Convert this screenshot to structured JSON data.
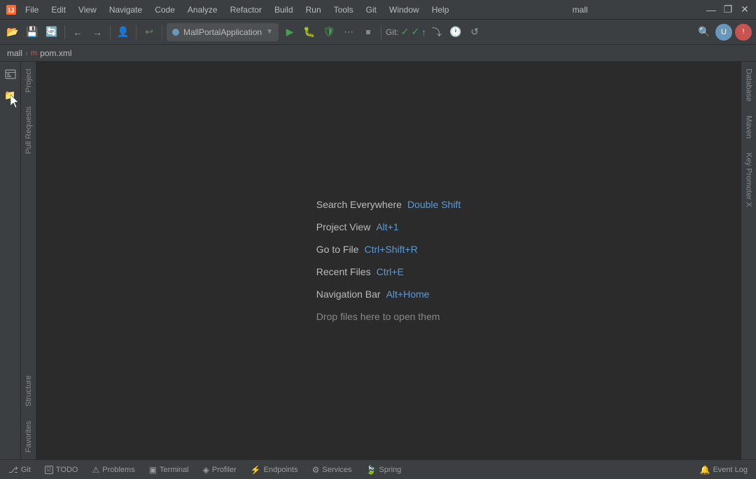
{
  "titlebar": {
    "app_name": "mall",
    "controls": {
      "minimize": "—",
      "maximize": "❐",
      "close": "✕"
    }
  },
  "menu": {
    "items": [
      "File",
      "Edit",
      "View",
      "Navigate",
      "Code",
      "Analyze",
      "Refactor",
      "Build",
      "Run",
      "Tools",
      "Git",
      "Window",
      "Help"
    ]
  },
  "title_center": "mall",
  "toolbar": {
    "run_config_label": "MallPortalApplication",
    "git_label": "Git:"
  },
  "breadcrumb": {
    "project": "mall",
    "file": "pom.xml"
  },
  "left_sidebar": {
    "labels": [
      "Project",
      "Pull Requests",
      "Structure",
      "Favorites"
    ]
  },
  "right_sidebar": {
    "labels": [
      "Database",
      "Maven",
      "Key Promoter X"
    ]
  },
  "welcome": {
    "rows": [
      {
        "label": "Search Everywhere",
        "key": "Double Shift"
      },
      {
        "label": "Project View",
        "key": "Alt+1"
      },
      {
        "label": "Go to File",
        "key": "Ctrl+Shift+R"
      },
      {
        "label": "Recent Files",
        "key": "Ctrl+E"
      },
      {
        "label": "Navigation Bar",
        "key": "Alt+Home"
      }
    ],
    "drop_hint": "Drop files here to open them"
  },
  "statusbar": {
    "git_label": "Git",
    "todo_label": "TODO",
    "problems_label": "Problems",
    "terminal_label": "Terminal",
    "profiler_label": "Profiler",
    "endpoints_label": "Endpoints",
    "services_label": "Services",
    "spring_label": "Spring",
    "event_log_label": "Event Log"
  }
}
